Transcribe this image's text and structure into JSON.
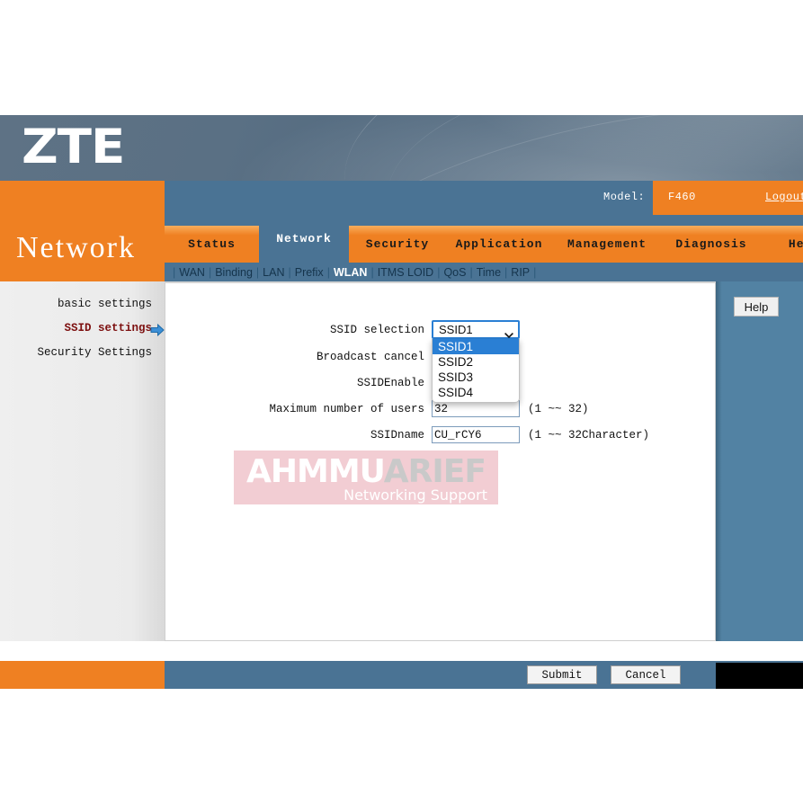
{
  "brand": {
    "logo_text": "ZTE",
    "section_title": "Network"
  },
  "header": {
    "model_label": "Model:",
    "model_value": "F460",
    "logout_label": "Logout"
  },
  "tabs": [
    {
      "label": "Status",
      "active": false
    },
    {
      "label": "Network",
      "active": true
    },
    {
      "label": "Security",
      "active": false
    },
    {
      "label": "Application",
      "active": false
    },
    {
      "label": "Management",
      "active": false
    },
    {
      "label": "Diagnosis",
      "active": false
    },
    {
      "label": "Help",
      "active": false
    }
  ],
  "subnav": [
    {
      "label": "WAN",
      "active": false
    },
    {
      "label": "Binding",
      "active": false
    },
    {
      "label": "LAN",
      "active": false
    },
    {
      "label": "Prefix",
      "active": false
    },
    {
      "label": "WLAN",
      "active": true
    },
    {
      "label": "ITMS LOID",
      "active": false
    },
    {
      "label": "QoS",
      "active": false
    },
    {
      "label": "Time",
      "active": false
    },
    {
      "label": "RIP",
      "active": false
    }
  ],
  "sidebar": {
    "items": [
      {
        "label": "basic settings",
        "active": false
      },
      {
        "label": "SSID settings",
        "active": true
      },
      {
        "label": "Security Settings",
        "active": false
      }
    ]
  },
  "help": {
    "button_label": "Help"
  },
  "form": {
    "ssid_selection": {
      "label": "SSID selection",
      "value": "SSID1",
      "open": true,
      "options": [
        "SSID1",
        "SSID2",
        "SSID3",
        "SSID4"
      ],
      "selected_index": 0
    },
    "broadcast_cancel": {
      "label": "Broadcast cancel",
      "checked": false
    },
    "ssid_enable": {
      "label": "SSIDEnable",
      "checked": true
    },
    "max_users": {
      "label": "Maximum number of users",
      "value": "32",
      "hint": "(1 ~~ 32)"
    },
    "ssid_name": {
      "label": "SSIDname",
      "value": "CU_rCY6",
      "hint": "(1 ~~ 32Character)"
    }
  },
  "footer": {
    "submit_label": "Submit",
    "cancel_label": "Cancel"
  },
  "watermark": {
    "text_a": "AHMMU",
    "text_b": "ARIEF",
    "tagline": "Networking Support"
  },
  "colors": {
    "orange": "#ef8022",
    "blue_gray": "#4a7394",
    "help_panel": "#5282a3",
    "accent_select": "#2a7fd4",
    "active_side": "#7d1010",
    "watermark_bg": "#f2cdd3"
  }
}
